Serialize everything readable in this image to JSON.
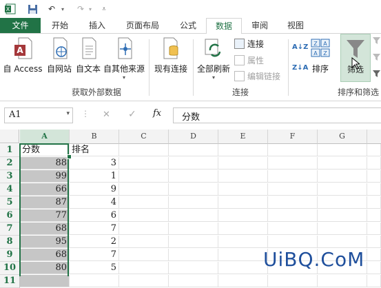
{
  "quick_access": {
    "excel_icon": "excel-app-icon",
    "save_icon": "save-icon",
    "undo_icon": "undo-icon",
    "redo_icon": "redo-icon",
    "customize_icon": "customize-qat-icon"
  },
  "tabs": [
    {
      "label": "文件"
    },
    {
      "label": "开始"
    },
    {
      "label": "插入"
    },
    {
      "label": "页面布局"
    },
    {
      "label": "公式"
    },
    {
      "label": "数据"
    },
    {
      "label": "审阅"
    },
    {
      "label": "视图"
    }
  ],
  "ribbon": {
    "external": {
      "access": "自 Access",
      "web": "自网站",
      "text": "自文本",
      "other": "自其他来源",
      "existing": "现有连接",
      "group_label": "获取外部数据"
    },
    "connections": {
      "refresh_all": "全部刷新",
      "connections": "连接",
      "properties": "属性",
      "edit_links": "编辑链接",
      "group_label": "连接"
    },
    "sort_filter": {
      "sort_az": "A↓Z",
      "sort_za": "Z↓A",
      "sort": "排序",
      "filter": "筛选",
      "group_label": "排序和筛选"
    }
  },
  "formula_bar": {
    "name_box": "A1",
    "cancel": "✕",
    "enter": "✓",
    "fx": "fx",
    "value": "分数"
  },
  "sheet": {
    "columns": [
      "A",
      "B",
      "C",
      "D",
      "E",
      "F",
      "G"
    ],
    "rows": [
      {
        "n": "1",
        "a": "分数",
        "b": "排名"
      },
      {
        "n": "2",
        "a": "88",
        "b": "3"
      },
      {
        "n": "3",
        "a": "99",
        "b": "1"
      },
      {
        "n": "4",
        "a": "66",
        "b": "9"
      },
      {
        "n": "5",
        "a": "87",
        "b": "4"
      },
      {
        "n": "6",
        "a": "77",
        "b": "6"
      },
      {
        "n": "7",
        "a": "68",
        "b": "7"
      },
      {
        "n": "8",
        "a": "95",
        "b": "2"
      },
      {
        "n": "9",
        "a": "68",
        "b": "7"
      },
      {
        "n": "10",
        "a": "80",
        "b": "5"
      },
      {
        "n": "11",
        "a": "",
        "b": ""
      }
    ]
  },
  "watermark": "UiBQ.CoM",
  "colors": {
    "excel_green": "#217346",
    "selection_gray": "#c6c6c6",
    "watermark_blue": "#1f4f9c"
  }
}
